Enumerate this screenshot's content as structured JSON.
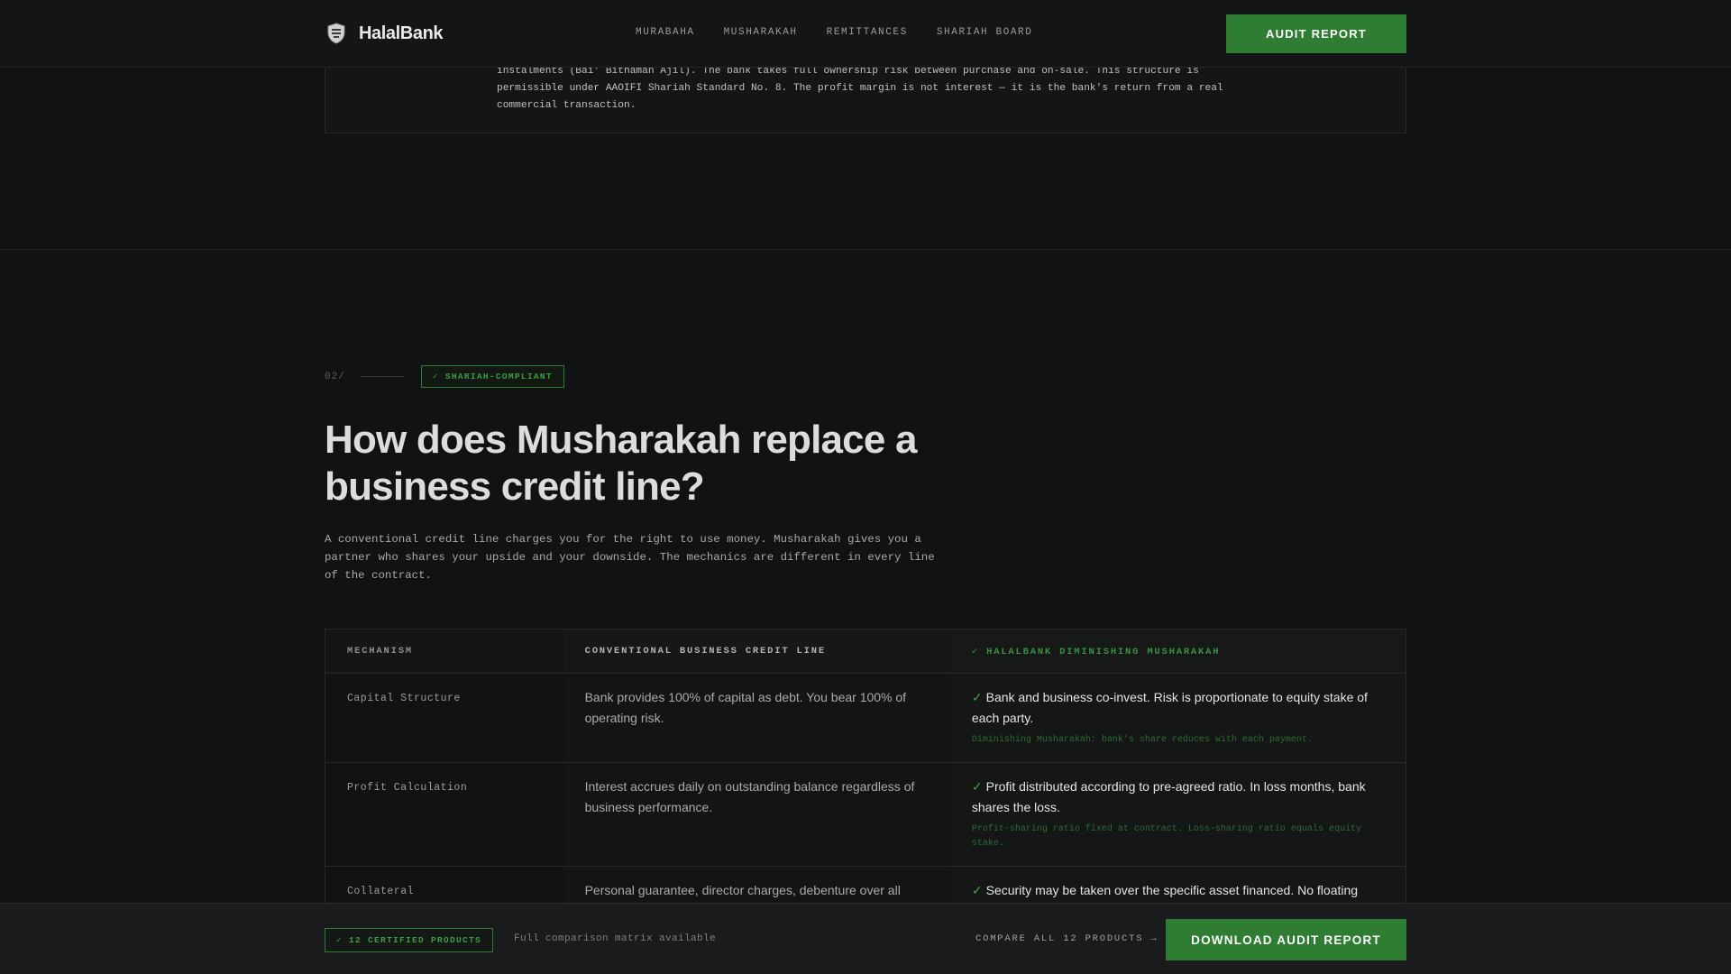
{
  "header": {
    "brand": "HalalBank",
    "logo_icon": "shield-crest-icon",
    "nav": [
      "MURABAHA",
      "MUSHARAKAH",
      "REMITTANCES",
      "SHARIAH BOARD"
    ],
    "cta": "AUDIT REPORT"
  },
  "top_card": {
    "text": "instalments (Bai' Bithaman Ajil). The bank takes full ownership risk between purchase and on-sale. This structure is permissible under AAOIFI Shariah Standard No. 8. The profit margin is not interest — it is the bank's return from a real commercial transaction."
  },
  "section": {
    "number": "02/",
    "badge": "✓ SHARIAH-COMPLIANT",
    "title": "How does Musharakah replace a business credit line?",
    "lead": "A conventional credit line charges you for the right to use money. Musharakah gives you a partner who shares your upside and your downside. The mechanics are different in every line of the contract."
  },
  "table": {
    "headers": [
      "MECHANISM",
      "CONVENTIONAL BUSINESS CREDIT LINE",
      "✓ HALALBANK DIMINISHING MUSHARAKAH"
    ],
    "rows": [
      {
        "mechanism": "Capital Structure",
        "conventional": "Bank provides 100% of capital as debt. You bear 100% of operating risk.",
        "halal": "Bank and business co-invest. Risk is proportionate to equity stake of each party.",
        "halal_note": "Diminishing Musharakah: bank's share reduces with each payment."
      },
      {
        "mechanism": "Profit Calculation",
        "conventional": "Interest accrues daily on outstanding balance regardless of business performance.",
        "halal": "Profit distributed according to pre-agreed ratio. In loss months, bank shares the loss.",
        "halal_note": "Profit-sharing ratio fixed at contract. Loss-sharing ratio equals equity stake."
      },
      {
        "mechanism": "Collateral",
        "conventional": "Personal guarantee, director charges, debenture over all",
        "halal": "Security may be taken over the specific asset financed. No floating",
        "halal_note": ""
      }
    ],
    "check": "✓"
  },
  "bottom_bar": {
    "badge": "✓ 12 CERTIFIED PRODUCTS",
    "note": "Full comparison matrix available",
    "link": "COMPARE ALL 12 PRODUCTS →",
    "cta": "DOWNLOAD AUDIT REPORT"
  },
  "colors": {
    "accent": "#2e7d32",
    "background": "#111213"
  }
}
